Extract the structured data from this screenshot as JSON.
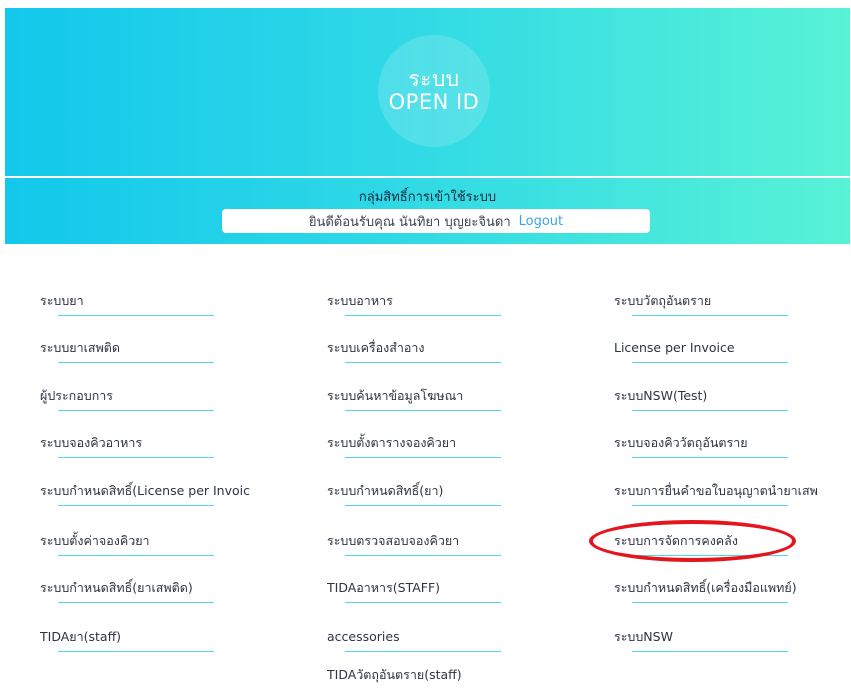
{
  "header": {
    "logo_line1": "ระบบ",
    "logo_line2": "OPEN ID",
    "group_label": "กลุ่มสิทธิ์การเข้าใช้ระบบ",
    "welcome_text": "ยินดีต้อนรับคุณ นันทิยา บุญยะจินดา",
    "logout_label": "Logout"
  },
  "menu": {
    "col1": [
      "ระบบยา",
      "ระบบยาเสพติด",
      "ผู้ประกอบการ",
      "ระบบจองคิวอาหาร",
      "ระบบกำหนดสิทธิ์(License per Invoice)",
      "ระบบตั้งค่าจองคิวยา",
      "ระบบกำหนดสิทธิ์(ยาเสพติด)",
      "TIDAยา(staff)"
    ],
    "col2": [
      "ระบบอาหาร",
      "ระบบเครื่องสำอาง",
      "ระบบค้นหาข้อมูลโฆษณา",
      "ระบบตั้งตารางจองคิวยา",
      "ระบบกำหนดสิทธิ์(ยา)",
      "ระบบตรวจสอบจองคิวยา",
      "TIDAอาหาร(STAFF)",
      "accessories",
      "TIDAวัตถุอันตราย(staff)"
    ],
    "col3": [
      "ระบบวัตถุอันตราย",
      "License per Invoice",
      "ระบบNSW(Test)",
      "ระบบจองคิววัตถุอันตราย",
      "ระบบการยื่นคำขอใบอนุญาตนำยาเสพ",
      "ระบบการจัดการคงคลัง",
      "ระบบกำหนดสิทธิ์(เครื่องมือแพทย์)",
      "ระบบNSW"
    ]
  },
  "colors": {
    "highlight": "#e4151c",
    "banner_start": "#13c8ec",
    "banner_end": "#58f2d6"
  }
}
